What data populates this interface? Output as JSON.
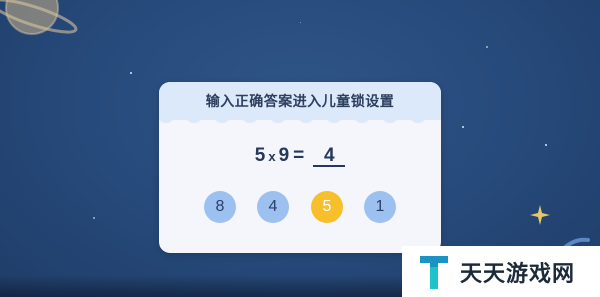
{
  "dialog": {
    "title": "输入正确答案进入儿童锁设置",
    "equation": {
      "left": "5",
      "operator": "x",
      "right": "9",
      "equals": "=",
      "answer": "4"
    },
    "options": [
      "8",
      "4",
      "5",
      "1"
    ],
    "selected_option_index": 2
  },
  "brand": {
    "name": "天天游戏网"
  },
  "colors": {
    "background": "#26497a",
    "dialog_header": "#dbe9fb",
    "option_default": "#9cc0ef",
    "option_selected": "#f7bf2c",
    "text_dark": "#24395c",
    "logo_teal": "#1ec2c8"
  }
}
